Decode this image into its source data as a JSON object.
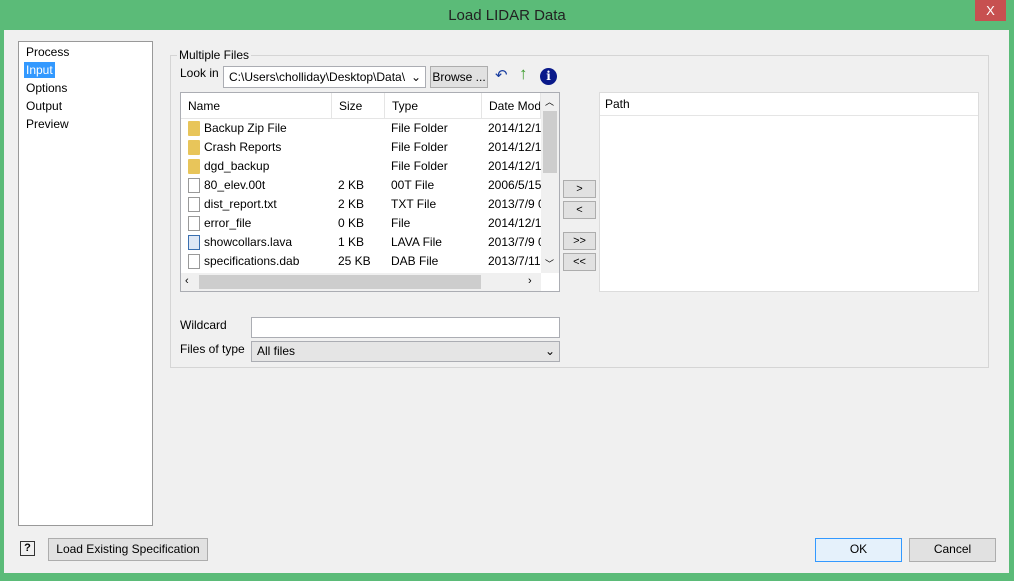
{
  "window": {
    "title": "Load LIDAR Data",
    "close": "X"
  },
  "nav": {
    "items": [
      {
        "label": "Process"
      },
      {
        "label": "Input"
      },
      {
        "label": "Options"
      },
      {
        "label": "Output"
      },
      {
        "label": "Preview"
      }
    ]
  },
  "group": {
    "title": "Multiple Files",
    "look_in_label": "Look in",
    "look_in_value": "C:\\Users\\cholliday\\Desktop\\Data\\",
    "browse": "Browse ...",
    "columns": [
      "Name",
      "Size",
      "Type",
      "Date Mod"
    ],
    "files": [
      {
        "name": "Backup Zip File",
        "size": "",
        "type": "File Folder",
        "date": "2014/12/1(",
        "icon": "folder"
      },
      {
        "name": "Crash Reports",
        "size": "",
        "type": "File Folder",
        "date": "2014/12/1(",
        "icon": "folder"
      },
      {
        "name": "dgd_backup",
        "size": "",
        "type": "File Folder",
        "date": "2014/12/1(",
        "icon": "folder"
      },
      {
        "name": "80_elev.00t",
        "size": "2 KB",
        "type": "00T File",
        "date": "2006/5/15",
        "icon": "file"
      },
      {
        "name": "dist_report.txt",
        "size": "2 KB",
        "type": "TXT File",
        "date": "2013/7/9 0",
        "icon": "file"
      },
      {
        "name": "error_file",
        "size": "0 KB",
        "type": " File",
        "date": "2014/12/1(",
        "icon": "file"
      },
      {
        "name": "showcollars.lava",
        "size": "1 KB",
        "type": "LAVA File",
        "date": "2013/7/9 0",
        "icon": "lava"
      },
      {
        "name": "specifications.dab",
        "size": "25 KB",
        "type": "DAB File",
        "date": "2013/7/11",
        "icon": "file"
      }
    ],
    "add": ">",
    "remove": "<",
    "add_all": ">>",
    "remove_all": "<<",
    "path_header": "Path",
    "wildcard_label": "Wildcard",
    "wildcard_value": "",
    "filetype_label": "Files of type",
    "filetype_value": "All files"
  },
  "footer": {
    "help": "?",
    "load_spec": "Load Existing Specification",
    "ok": "OK",
    "cancel": "Cancel"
  }
}
